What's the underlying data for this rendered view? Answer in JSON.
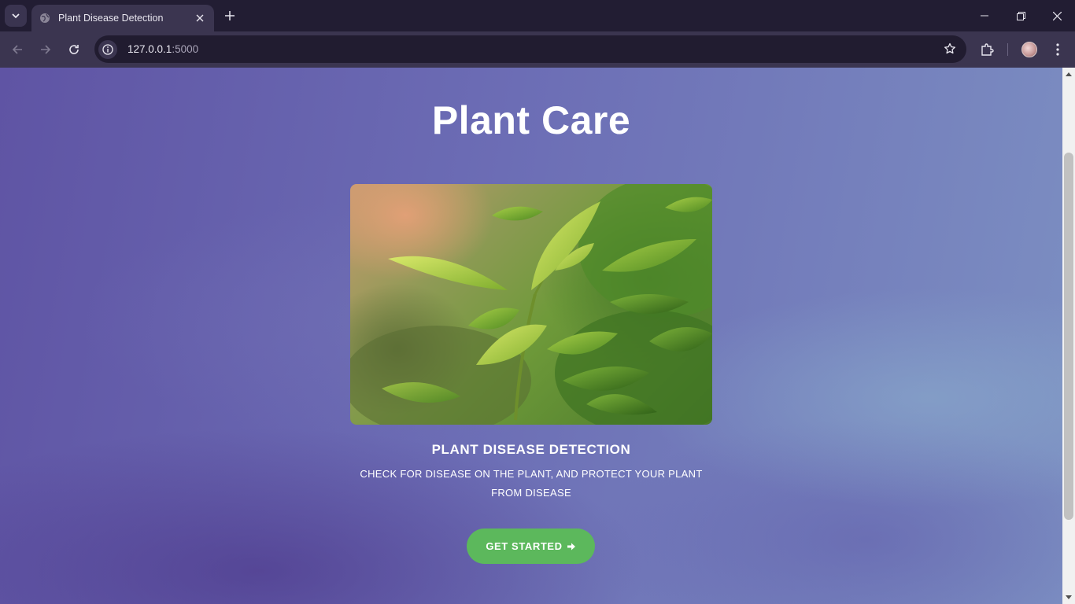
{
  "browser": {
    "tab_title": "Plant Disease Detection",
    "url_host": "127.0.0.1",
    "url_port": ":5000"
  },
  "page": {
    "title": "Plant Care",
    "hero_alt": "",
    "card": {
      "heading": "PLANT DISEASE DETECTION",
      "description": "CHECK FOR DISEASE ON THE PLANT, AND PROTECT YOUR PLANT FROM DISEASE"
    },
    "cta_label": "GET STARTED",
    "cta_icon": "arrow-right-icon"
  },
  "colors": {
    "cta_green": "#5cb85c",
    "chrome_dark": "#221d33",
    "toolbar": "#3b3550"
  }
}
